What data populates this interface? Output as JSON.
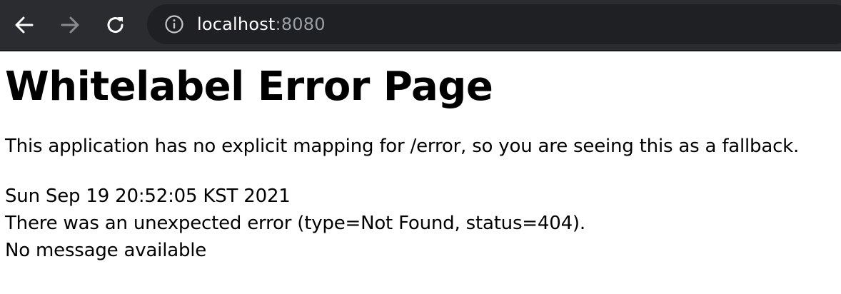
{
  "browser": {
    "url_host": "localhost",
    "url_port": ":8080",
    "icons": {
      "back": "arrow-left-icon",
      "forward": "arrow-right-icon",
      "reload": "reload-icon",
      "site_info": "info-icon"
    },
    "colors": {
      "toolbar_bg": "#2b2c2f",
      "omnibox_bg": "#1f2023",
      "host_text": "#ffffff",
      "port_text": "#9aa0a6"
    }
  },
  "page": {
    "title": "Whitelabel Error Page",
    "fallback_message": "This application has no explicit mapping for /error, so you are seeing this as a fallback.",
    "timestamp": "Sun Sep 19 20:52:05 KST 2021",
    "error_line": "There was an unexpected error (type=Not Found, status=404).",
    "message_line": "No message available"
  }
}
